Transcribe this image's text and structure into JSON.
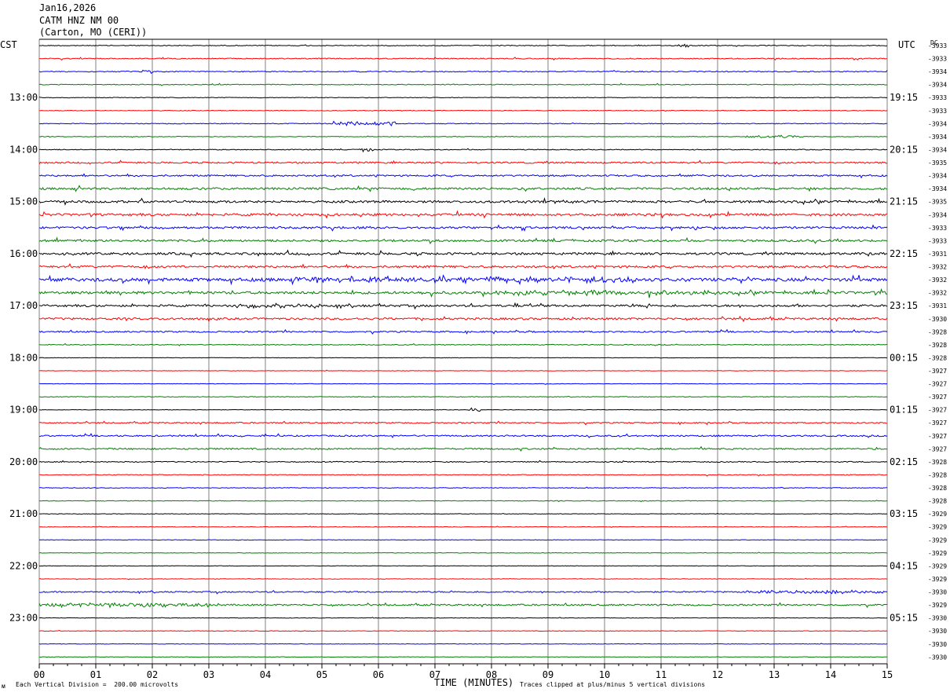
{
  "header": {
    "date": "Jan16,2026",
    "station": "CATM HNZ NM 00",
    "location": "(Carton, MO (CERI))"
  },
  "left_timezone": "CST",
  "right_timezone": "UTC",
  "dc_label": "DC",
  "footer": {
    "scale_note": "Each Vertical Division =  200.00 microvolts",
    "xlabel": "TIME (MINUTES)",
    "clip_note": "Traces clipped at plus/minus 5 vertical divisions"
  },
  "colors": {
    "trace_cycle": [
      "#000000",
      "#ff0000",
      "#0000ff",
      "#008000"
    ],
    "gridline": "#808080"
  },
  "chart_data": {
    "type": "line",
    "title": "CATM HNZ NM 00 (Carton, MO (CERI)) Jan16,2026",
    "xlabel": "TIME (MINUTES)",
    "xlim": [
      0,
      15
    ],
    "x_ticks": [
      "00",
      "01",
      "02",
      "03",
      "04",
      "05",
      "06",
      "07",
      "08",
      "09",
      "10",
      "11",
      "12",
      "13",
      "14",
      "15"
    ],
    "left_time_labels": [
      "13:00",
      "14:00",
      "15:00",
      "16:00",
      "17:00",
      "18:00",
      "19:00",
      "20:00",
      "21:00",
      "22:00",
      "23:00"
    ],
    "right_time_labels": [
      "19:15",
      "20:15",
      "21:15",
      "22:15",
      "23:15",
      "00:15",
      "01:15",
      "02:15",
      "03:15",
      "04:15",
      "05:15"
    ],
    "traces_per_hour": 4,
    "first_label_trace_index": 4,
    "dc_offsets": [
      "-3933",
      "-3933",
      "-3934",
      "-3934",
      "-3933",
      "-3933",
      "-3934",
      "-3934",
      "-3934",
      "-3935",
      "-3934",
      "-3934",
      "-3935",
      "-3934",
      "-3933",
      "-3933",
      "-3931",
      "-3932",
      "-3932",
      "-3932",
      "-3931",
      "-3930",
      "-3928",
      "-3928",
      "-3928",
      "-3927",
      "-3927",
      "-3927",
      "-3927",
      "-3927",
      "-3927",
      "-3927",
      "-3928",
      "-3928",
      "-3928",
      "-3928",
      "-3929",
      "-3929",
      "-3929",
      "-3929",
      "-3929",
      "-3929",
      "-3930",
      "-3929",
      "-3930",
      "-3930",
      "-3930",
      "-3930"
    ],
    "trace_noise_levels": [
      0.5,
      0.6,
      0.6,
      0.5,
      0.4,
      0.4,
      0.5,
      0.4,
      0.5,
      1.0,
      1.0,
      1.3,
      1.4,
      1.4,
      1.3,
      1.3,
      1.4,
      1.3,
      2.0,
      1.6,
      1.3,
      1.2,
      0.9,
      0.5,
      0.3,
      0.3,
      0.3,
      0.4,
      0.3,
      0.8,
      0.9,
      0.9,
      0.6,
      0.5,
      0.4,
      0.4,
      0.3,
      0.3,
      0.3,
      0.3,
      0.3,
      0.3,
      0.8,
      1.0,
      0.3,
      0.3,
      0.3,
      0.3
    ],
    "events": [
      {
        "trace": 6,
        "start_min": 5.2,
        "end_min": 6.3,
        "amplitude": 2.5
      },
      {
        "trace": 7,
        "start_min": 12.5,
        "end_min": 13.5,
        "amplitude": 1.5
      },
      {
        "trace": 8,
        "start_min": 5.7,
        "end_min": 5.9,
        "amplitude": 2.5
      },
      {
        "trace": 18,
        "start_min": 4.5,
        "end_min": 10.5,
        "amplitude": 2.5
      },
      {
        "trace": 19,
        "start_min": 8.0,
        "end_min": 12.0,
        "amplitude": 2.0
      },
      {
        "trace": 20,
        "start_min": 3.5,
        "end_min": 5.0,
        "amplitude": 1.8
      },
      {
        "trace": 42,
        "start_min": 12.5,
        "end_min": 15.0,
        "amplitude": 1.5
      },
      {
        "trace": 43,
        "start_min": 0.0,
        "end_min": 3.0,
        "amplitude": 1.8
      },
      {
        "trace": 0,
        "start_min": 11.3,
        "end_min": 11.5,
        "amplitude": 2.0
      },
      {
        "trace": 2,
        "start_min": 1.8,
        "end_min": 2.0,
        "amplitude": 2.0
      },
      {
        "trace": 28,
        "start_min": 7.6,
        "end_min": 7.8,
        "amplitude": 2.0
      }
    ]
  }
}
